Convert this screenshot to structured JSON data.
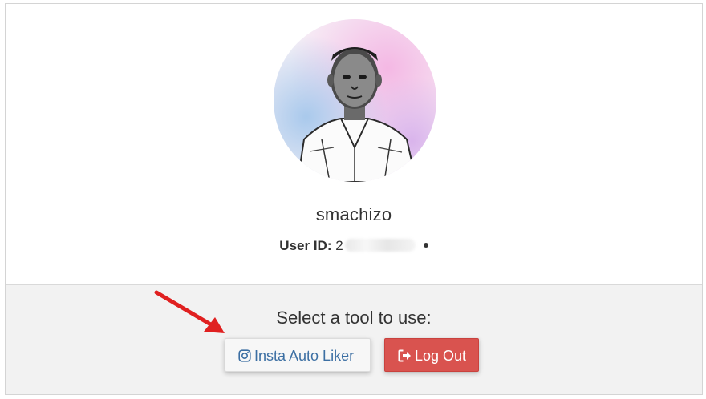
{
  "profile": {
    "username": "smachizo",
    "user_id_label": "User ID:",
    "user_id_visible": "2"
  },
  "tools": {
    "title": "Select a tool to use:",
    "insta_label": "Insta Auto Liker",
    "logout_label": "Log Out"
  },
  "icons": {
    "insta": "instagram-icon",
    "logout": "sign-out-icon",
    "annotation": "red-arrow"
  },
  "colors": {
    "logout_bg": "#d9534f",
    "insta_text": "#3c6fa3",
    "arrow": "#e02020",
    "panel_bg": "#f2f2f2"
  }
}
